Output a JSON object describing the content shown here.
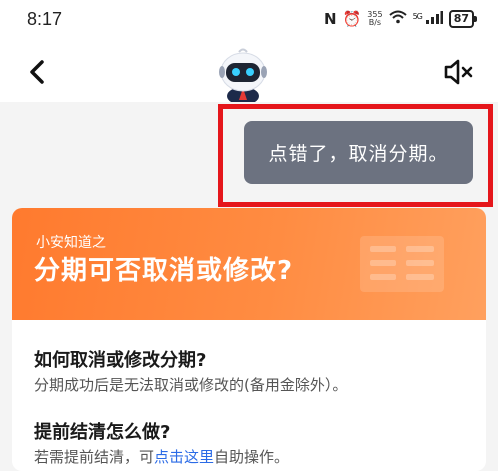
{
  "status_bar": {
    "time": "8:17",
    "nfc_icon": "N",
    "alarm_icon": "⏰",
    "net_speed_value": "355",
    "net_speed_unit": "B/s",
    "wifi_icon": "wifi-icon",
    "signal_label": "5G",
    "battery": "87"
  },
  "header": {
    "back_icon": "chevron-left-icon",
    "mute_icon": "speaker-muted-icon",
    "avatar_icon": "robot-avatar-icon"
  },
  "chat": {
    "user_message": "点错了，取消分期。"
  },
  "card": {
    "banner_subtitle": "小安知道之",
    "banner_title": "分期可否取消或修改?",
    "q1": "如何取消或修改分期?",
    "a1": "分期成功后是无法取消或修改的(备用金除外）。",
    "q2": "提前结清怎么做?",
    "a2_prefix": "若需提前结清，可",
    "a2_link": "点击这里",
    "a2_suffix": "自助操作。"
  },
  "colors": {
    "accent_orange": "#ff7a2e",
    "bubble_gray": "#6c7280",
    "highlight_red": "#e5161b",
    "link_blue": "#2b6be6"
  }
}
